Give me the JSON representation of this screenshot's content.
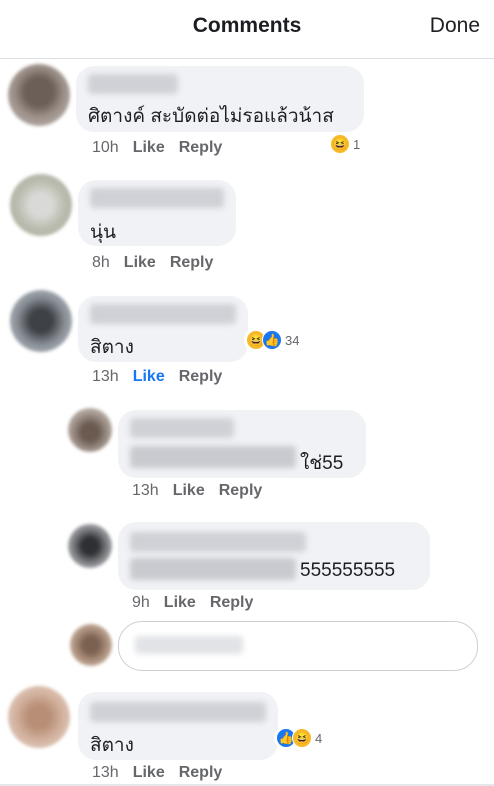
{
  "header": {
    "title": "Comments",
    "done_label": "Done"
  },
  "colors": {
    "accent": "#1877f2",
    "bubble": "#f0f2f5",
    "meta": "#65676b"
  },
  "comments": [
    {
      "text": "ศิตางค์ สะบัดต่อไม่รอแล้วน้าส",
      "time": "10h",
      "like": "Like",
      "reply": "Reply",
      "reactions": [
        "haha-icon"
      ],
      "count": "1"
    },
    {
      "text": "นุ่น",
      "time": "8h",
      "like": "Like",
      "reply": "Reply"
    },
    {
      "text": "สิตาง",
      "time": "13h",
      "like": "Like",
      "reply": "Reply",
      "liked": true,
      "reactions": [
        "haha-icon",
        "like-icon"
      ],
      "count": "34"
    },
    {
      "text": "ใช่55",
      "time": "13h",
      "like": "Like",
      "reply": "Reply"
    },
    {
      "text": "555555555",
      "time": "9h",
      "like": "Like",
      "reply": "Reply"
    },
    {
      "text": "สิตาง",
      "time": "13h",
      "like": "Like",
      "reply": "Reply",
      "reactions": [
        "like-icon",
        "haha-icon"
      ],
      "count": "4"
    }
  ]
}
